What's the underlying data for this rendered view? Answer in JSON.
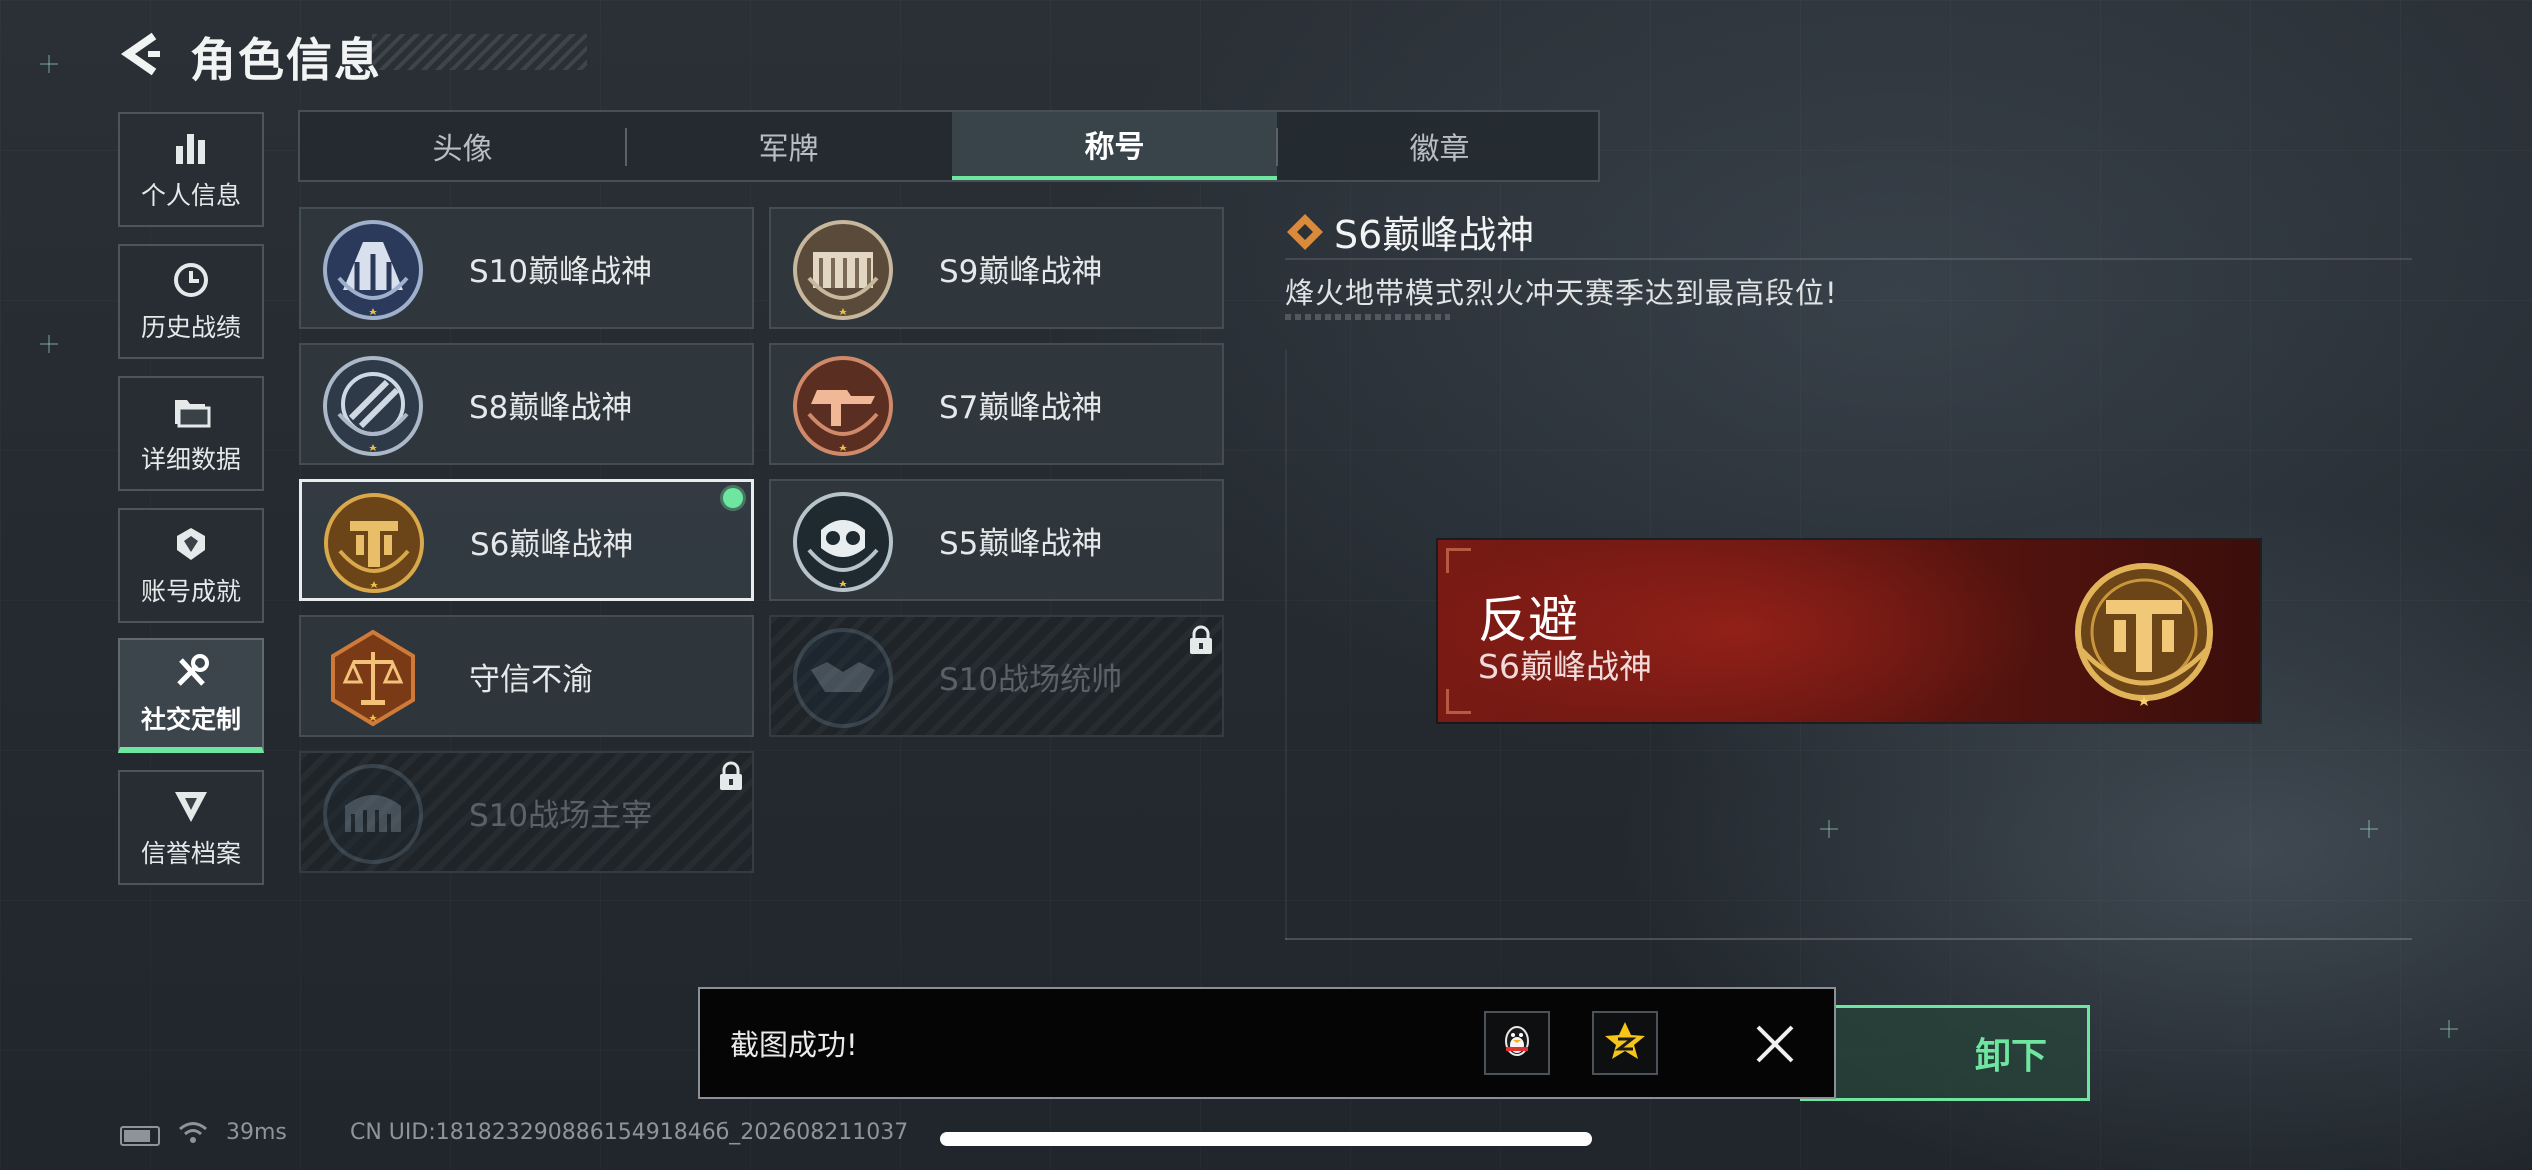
{
  "header": {
    "title": "角色信息"
  },
  "sidebar": {
    "items": [
      {
        "label": "个人信息",
        "icon": "bar-chart-icon",
        "active": false
      },
      {
        "label": "历史战绩",
        "icon": "clock-icon",
        "active": false
      },
      {
        "label": "详细数据",
        "icon": "folder-icon",
        "active": false
      },
      {
        "label": "账号成就",
        "icon": "achievement-icon",
        "active": false
      },
      {
        "label": "社交定制",
        "icon": "tools-icon",
        "active": true
      },
      {
        "label": "信誉档案",
        "icon": "credit-shield-icon",
        "active": false
      }
    ]
  },
  "tabs": [
    {
      "label": "头像",
      "active": false
    },
    {
      "label": "军牌",
      "active": false
    },
    {
      "label": "称号",
      "active": true
    },
    {
      "label": "徽章",
      "active": false
    }
  ],
  "titles": [
    {
      "name": "S10巅峰战神",
      "state": "unlocked"
    },
    {
      "name": "S9巅峰战神",
      "state": "unlocked"
    },
    {
      "name": "S8巅峰战神",
      "state": "unlocked"
    },
    {
      "name": "S7巅峰战神",
      "state": "unlocked"
    },
    {
      "name": "S6巅峰战神",
      "state": "selected-equipped"
    },
    {
      "name": "S5巅峰战神",
      "state": "unlocked"
    },
    {
      "name": "守信不渝",
      "state": "unlocked"
    },
    {
      "name": "S10战场统帅",
      "state": "locked"
    },
    {
      "name": "S10战场主宰",
      "state": "locked"
    }
  ],
  "detail": {
    "title": "S6巅峰战神",
    "description": "烽火地带模式烈火冲天赛季达到最高段位!"
  },
  "preview": {
    "player_name": "反避",
    "title": "S6巅峰战神"
  },
  "confirm_button": {
    "label_visible": "卸下"
  },
  "toast": {
    "message": "截图成功!",
    "share_targets": [
      "qq-penguin-icon",
      "qzone-star-icon"
    ]
  },
  "status_bar": {
    "ping": "39ms",
    "uid": "CN UID:18182329088615491846б_202608211037"
  },
  "colors": {
    "accent_green": "#6ee6a0",
    "banner_red": "#7a1a14",
    "emblem_gold": "#c9973a"
  }
}
